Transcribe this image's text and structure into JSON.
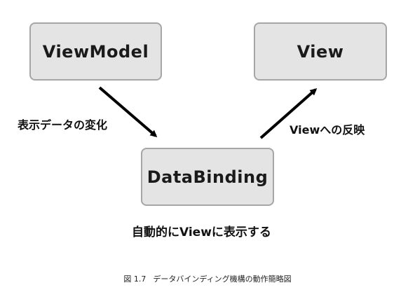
{
  "nodes": {
    "viewmodel": "ViewModel",
    "view": "View",
    "databinding": "DataBinding"
  },
  "edges": {
    "viewmodel_to_databinding": "表示データの変化",
    "databinding_to_view": "Viewへの反映"
  },
  "note": "自動的にViewに表示する",
  "caption": {
    "number": "図 1.7",
    "text": "データバインディング機構の動作簡略図"
  }
}
